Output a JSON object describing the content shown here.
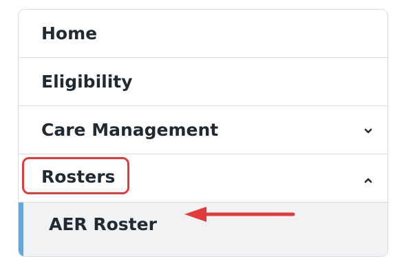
{
  "nav": {
    "items": [
      {
        "label": "Home"
      },
      {
        "label": "Eligibility"
      },
      {
        "label": "Care Management",
        "icon": "chevron-down-icon"
      },
      {
        "label": "Rosters",
        "icon": "chevron-up-icon",
        "highlighted": true
      }
    ],
    "subitem": {
      "label": "AER Roster",
      "active": true
    }
  },
  "colors": {
    "highlight_red": "#e23b3b",
    "active_accent": "#5ea8ec",
    "text": "#1f2a33"
  }
}
